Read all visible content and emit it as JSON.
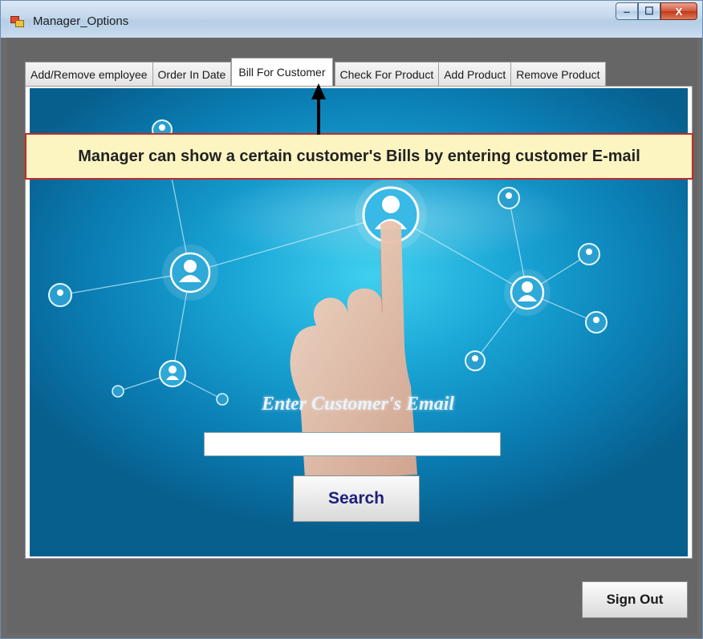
{
  "window": {
    "title": "Manager_Options",
    "controls": {
      "minimize": "‒",
      "maximize": "☐",
      "close": "X"
    }
  },
  "tabs": [
    {
      "label": "Add/Remove employee",
      "active": false
    },
    {
      "label": "Order In Date",
      "active": false
    },
    {
      "label": "Bill For Customer",
      "active": true
    },
    {
      "label": "Check For Product",
      "active": false
    },
    {
      "label": "Add Product",
      "active": false
    },
    {
      "label": "Remove Product",
      "active": false
    }
  ],
  "annotation": {
    "text": "Manager can show a certain customer's Bills by entering customer E-mail"
  },
  "bill_for_customer": {
    "email_label": "Enter Customer's Email",
    "email_value": "",
    "search_label": "Search"
  },
  "footer": {
    "sign_out_label": "Sign Out"
  },
  "colors": {
    "annotation_border": "#c32a2a",
    "annotation_fill": "#fcf5c2",
    "scene_blue": "#1aa6d6",
    "search_text": "#1d1f7a"
  },
  "icons": [
    "app-icon",
    "person-node-icon",
    "arrow-up-icon"
  ]
}
